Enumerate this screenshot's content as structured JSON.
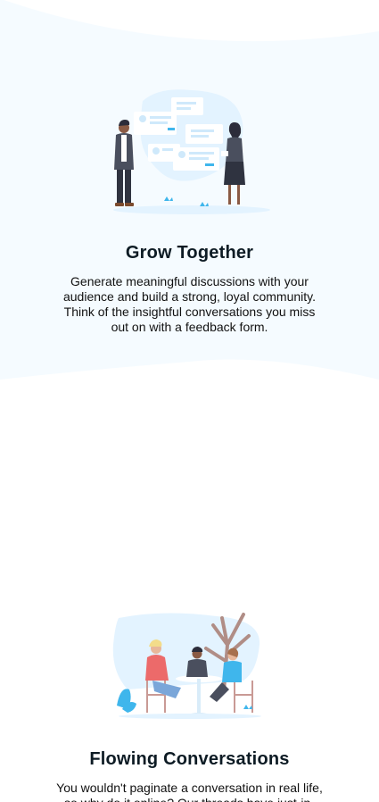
{
  "features": [
    {
      "title": "Grow Together",
      "description": "Generate meaningful discussions with your audience and build a strong, loyal community. Think of the insightful conversations you miss out on with a feedback form.",
      "illustration": "people-discussing-illustration"
    },
    {
      "title": "Flowing Conversations",
      "description": "You wouldn't paginate a conversation in real life, so why do it online? Our threads have just-in-",
      "illustration": "friends-at-table-illustration"
    }
  ],
  "colors": {
    "band_background": "#f5fbff",
    "illustration_blob": "#e3f3ff",
    "accent_blue": "#3fb6ec",
    "heading": "#0d1b24"
  }
}
